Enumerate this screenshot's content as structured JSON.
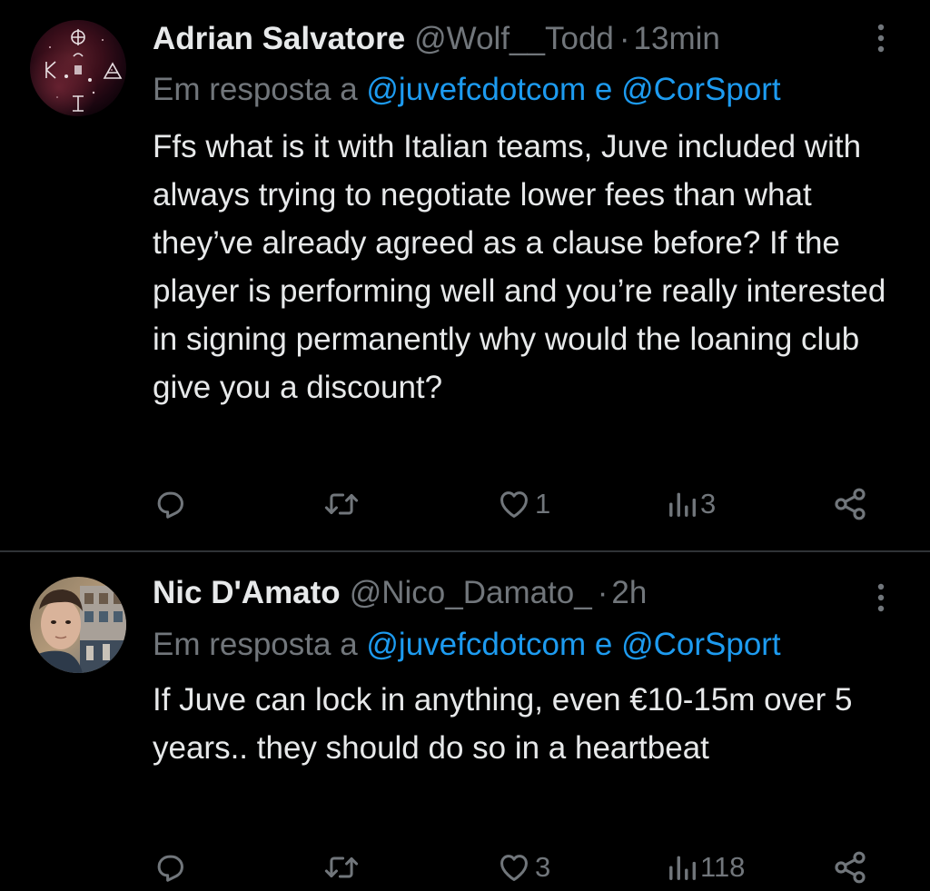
{
  "tweets": [
    {
      "author_name": "Adrian Salvatore",
      "handle": "@Wolf__Todd",
      "separator": "·",
      "time": "13min",
      "reply_prefix": "Em resposta a",
      "mention_1": "@juvefcdotcom",
      "reply_joiner": "e",
      "mention_2": "@CorSport",
      "text": "Ffs what is it with Italian teams, Juve included with always trying to negotiate lower fees than what they’ve already agreed as a clause before? If the player is performing well and you’re really interested in signing permanently why would the loaning club give you a discount?",
      "likes": "1",
      "views": "3",
      "avatar_icon": "occult-symbols-avatar"
    },
    {
      "author_name": "Nic D'Amato",
      "handle": "@Nico_Damato_",
      "separator": "·",
      "time": "2h",
      "reply_prefix": "Em resposta a",
      "mention_1": "@juvefcdotcom",
      "reply_joiner": "e",
      "mention_2": "@CorSport",
      "text": "If Juve can lock in anything, even €10-15m over 5 years.. they should do so in a heartbeat",
      "likes": "3",
      "views": "118",
      "avatar_icon": "person-photo-avatar"
    }
  ],
  "icons": {
    "reply": "reply-icon",
    "repost": "repost-icon",
    "like": "heart-icon",
    "views": "views-bar-chart-icon",
    "share": "share-icon",
    "more": "more-vertical-icon"
  },
  "colors": {
    "background": "#000000",
    "text": "#e7e9ea",
    "secondary": "#71767b",
    "link": "#1d9bf0",
    "divider": "#2f3336"
  }
}
